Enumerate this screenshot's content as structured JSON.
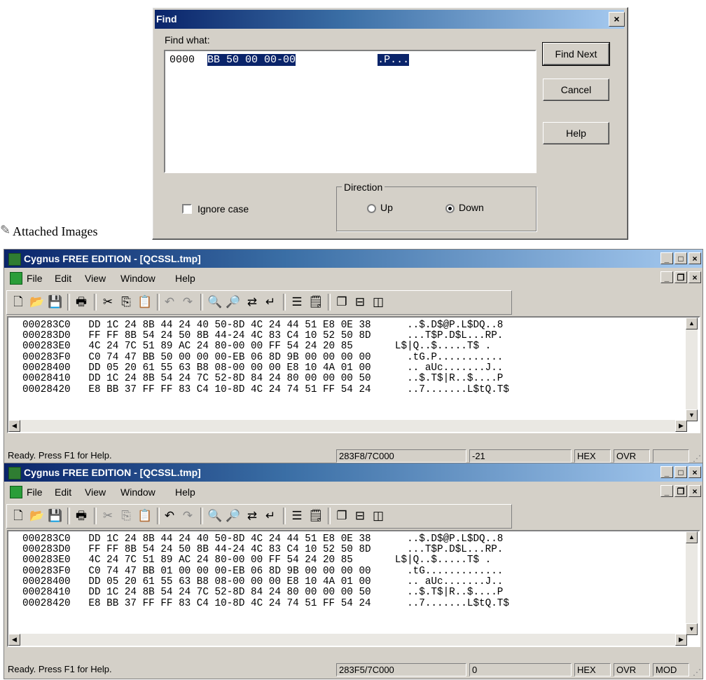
{
  "find_dialog": {
    "title": "Find",
    "close_glyph": "×",
    "find_what_label": "Find what:",
    "field_offset": "0000",
    "field_hex": "BB 50 00 00-00",
    "field_ascii": ".P...",
    "buttons": {
      "find_next": "Find Next",
      "cancel": "Cancel",
      "help": "Help"
    },
    "ignore_case_label": "Ignore case",
    "ignore_case_checked": false,
    "direction_label": "Direction",
    "direction_options": [
      "Up",
      "Down"
    ],
    "direction_selected": "Down"
  },
  "attached_label": "Attached Images",
  "windows": [
    {
      "title": "Cygnus FREE EDITION - [QCSSL.tmp]",
      "menu": [
        "File",
        "Edit",
        "View",
        "Window",
        "Help"
      ],
      "rows": [
        "000283C0   DD 1C 24 8B 44 24 40 50-8D 4C 24 44 51 E8 0E 38      ..$.D$@P.L$DQ..8",
        "000283D0   FF FF 8B 54 24 50 8B 44-24 4C 83 C4 10 52 50 8D      ...T$P.D$L...RP.",
        "000283E0   4C 24 7C 51 89 AC 24 80-00 00 FF 54 24 20 85       L$|Q..$.....T$ .",
        "000283F0   C0 74 47 BB 50 00 00 00-EB 06 8D 9B 00 00 00 00      .tG.P...........",
        "00028400   DD 05 20 61 55 63 B8 08-00 00 00 E8 10 4A 01 00      .. aUc.......J..",
        "00028410   DD 1C 24 8B 54 24 7C 52-8D 84 24 80 00 00 00 50      ..$.T$|R..$....P",
        "00028420   E8 BB 37 FF FF 83 C4 10-8D 4C 24 74 51 FF 54 24      ..7.......L$tQ.T$"
      ],
      "status": {
        "message": "Ready.  Press F1 for Help.",
        "position": "283F8/7C000",
        "value": "-21",
        "mode": "HEX",
        "overwrite": "OVR",
        "modified": ""
      }
    },
    {
      "title": "Cygnus FREE EDITION - [QCSSL.tmp]",
      "menu": [
        "File",
        "Edit",
        "View",
        "Window",
        "Help"
      ],
      "rows": [
        "000283C0   DD 1C 24 8B 44 24 40 50-8D 4C 24 44 51 E8 0E 38      ..$.D$@P.L$DQ..8",
        "000283D0   FF FF 8B 54 24 50 8B 44-24 4C 83 C4 10 52 50 8D      ...T$P.D$L...RP.",
        "000283E0   4C 24 7C 51 89 AC 24 80-00 00 FF 54 24 20 85       L$|Q..$.....T$ .",
        "000283F0   C0 74 47 BB 01 00 00 00-EB 06 8D 9B 00 00 00 00      .tG.............",
        "00028400   DD 05 20 61 55 63 B8 08-00 00 00 E8 10 4A 01 00      .. aUc.......J..",
        "00028410   DD 1C 24 8B 54 24 7C 52-8D 84 24 80 00 00 00 50      ..$.T$|R..$....P",
        "00028420   E8 BB 37 FF FF 83 C4 10-8D 4C 24 74 51 FF 54 24      ..7.......L$tQ.T$"
      ],
      "status": {
        "message": "Ready.  Press F1 for Help.",
        "position": "283F5/7C000",
        "value": "0",
        "mode": "HEX",
        "overwrite": "OVR",
        "modified": "MOD"
      }
    }
  ]
}
